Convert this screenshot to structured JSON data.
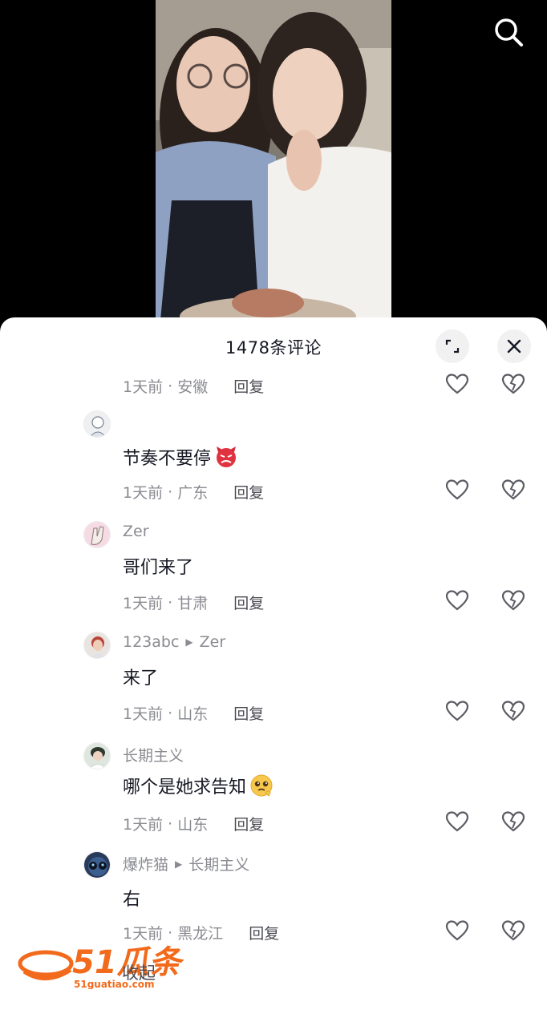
{
  "header": {
    "comment_count_title": "1478条评论"
  },
  "icons": {
    "search": "search-icon",
    "expand": "expand-icon",
    "close": "close-icon",
    "like": "heart-outline-icon",
    "dislike": "broken-heart-icon"
  },
  "first_meta": {
    "time": "1天前",
    "location": "安徽",
    "reply": "回复"
  },
  "comments": [
    {
      "user": "",
      "reply_to": "",
      "text": "节奏不要停",
      "emoji": "angry-devil-emoji",
      "time": "1天前",
      "location": "广东",
      "reply": "回复"
    },
    {
      "user": "Zer",
      "reply_to": "",
      "text": "哥们来了",
      "emoji": "",
      "time": "1天前",
      "location": "甘肃",
      "reply": "回复"
    },
    {
      "user": "123abc",
      "reply_to": "Zer",
      "text": "来了",
      "emoji": "",
      "time": "1天前",
      "location": "山东",
      "reply": "回复"
    },
    {
      "user": "长期主义",
      "reply_to": "",
      "text": "哪个是她求告知",
      "emoji": "pleading-face-emoji",
      "time": "1天前",
      "location": "山东",
      "reply": "回复"
    },
    {
      "user": "爆炸猫",
      "reply_to": "长期主义",
      "text": "右",
      "emoji": "",
      "time": "1天前",
      "location": "黑龙江",
      "reply": "回复"
    }
  ],
  "footer": {
    "collapse": "收起"
  },
  "watermark": {
    "brand": "51瓜条",
    "url": "51guatiao.com"
  },
  "colors": {
    "secondary_text": "#8a8b91",
    "primary_text": "#161823",
    "brand_orange": "#f26a1b"
  }
}
